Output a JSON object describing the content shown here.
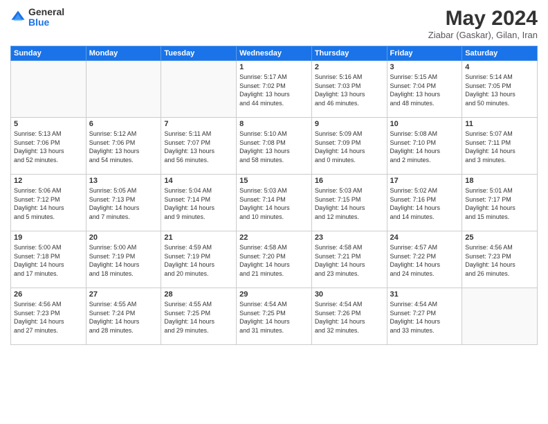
{
  "logo": {
    "general": "General",
    "blue": "Blue"
  },
  "header": {
    "month_year": "May 2024",
    "location": "Ziabar (Gaskar), Gilan, Iran"
  },
  "days_of_week": [
    "Sunday",
    "Monday",
    "Tuesday",
    "Wednesday",
    "Thursday",
    "Friday",
    "Saturday"
  ],
  "weeks": [
    [
      {
        "day": "",
        "info": ""
      },
      {
        "day": "",
        "info": ""
      },
      {
        "day": "",
        "info": ""
      },
      {
        "day": "1",
        "info": "Sunrise: 5:17 AM\nSunset: 7:02 PM\nDaylight: 13 hours\nand 44 minutes."
      },
      {
        "day": "2",
        "info": "Sunrise: 5:16 AM\nSunset: 7:03 PM\nDaylight: 13 hours\nand 46 minutes."
      },
      {
        "day": "3",
        "info": "Sunrise: 5:15 AM\nSunset: 7:04 PM\nDaylight: 13 hours\nand 48 minutes."
      },
      {
        "day": "4",
        "info": "Sunrise: 5:14 AM\nSunset: 7:05 PM\nDaylight: 13 hours\nand 50 minutes."
      }
    ],
    [
      {
        "day": "5",
        "info": "Sunrise: 5:13 AM\nSunset: 7:06 PM\nDaylight: 13 hours\nand 52 minutes."
      },
      {
        "day": "6",
        "info": "Sunrise: 5:12 AM\nSunset: 7:06 PM\nDaylight: 13 hours\nand 54 minutes."
      },
      {
        "day": "7",
        "info": "Sunrise: 5:11 AM\nSunset: 7:07 PM\nDaylight: 13 hours\nand 56 minutes."
      },
      {
        "day": "8",
        "info": "Sunrise: 5:10 AM\nSunset: 7:08 PM\nDaylight: 13 hours\nand 58 minutes."
      },
      {
        "day": "9",
        "info": "Sunrise: 5:09 AM\nSunset: 7:09 PM\nDaylight: 14 hours\nand 0 minutes."
      },
      {
        "day": "10",
        "info": "Sunrise: 5:08 AM\nSunset: 7:10 PM\nDaylight: 14 hours\nand 2 minutes."
      },
      {
        "day": "11",
        "info": "Sunrise: 5:07 AM\nSunset: 7:11 PM\nDaylight: 14 hours\nand 3 minutes."
      }
    ],
    [
      {
        "day": "12",
        "info": "Sunrise: 5:06 AM\nSunset: 7:12 PM\nDaylight: 14 hours\nand 5 minutes."
      },
      {
        "day": "13",
        "info": "Sunrise: 5:05 AM\nSunset: 7:13 PM\nDaylight: 14 hours\nand 7 minutes."
      },
      {
        "day": "14",
        "info": "Sunrise: 5:04 AM\nSunset: 7:14 PM\nDaylight: 14 hours\nand 9 minutes."
      },
      {
        "day": "15",
        "info": "Sunrise: 5:03 AM\nSunset: 7:14 PM\nDaylight: 14 hours\nand 10 minutes."
      },
      {
        "day": "16",
        "info": "Sunrise: 5:03 AM\nSunset: 7:15 PM\nDaylight: 14 hours\nand 12 minutes."
      },
      {
        "day": "17",
        "info": "Sunrise: 5:02 AM\nSunset: 7:16 PM\nDaylight: 14 hours\nand 14 minutes."
      },
      {
        "day": "18",
        "info": "Sunrise: 5:01 AM\nSunset: 7:17 PM\nDaylight: 14 hours\nand 15 minutes."
      }
    ],
    [
      {
        "day": "19",
        "info": "Sunrise: 5:00 AM\nSunset: 7:18 PM\nDaylight: 14 hours\nand 17 minutes."
      },
      {
        "day": "20",
        "info": "Sunrise: 5:00 AM\nSunset: 7:19 PM\nDaylight: 14 hours\nand 18 minutes."
      },
      {
        "day": "21",
        "info": "Sunrise: 4:59 AM\nSunset: 7:19 PM\nDaylight: 14 hours\nand 20 minutes."
      },
      {
        "day": "22",
        "info": "Sunrise: 4:58 AM\nSunset: 7:20 PM\nDaylight: 14 hours\nand 21 minutes."
      },
      {
        "day": "23",
        "info": "Sunrise: 4:58 AM\nSunset: 7:21 PM\nDaylight: 14 hours\nand 23 minutes."
      },
      {
        "day": "24",
        "info": "Sunrise: 4:57 AM\nSunset: 7:22 PM\nDaylight: 14 hours\nand 24 minutes."
      },
      {
        "day": "25",
        "info": "Sunrise: 4:56 AM\nSunset: 7:23 PM\nDaylight: 14 hours\nand 26 minutes."
      }
    ],
    [
      {
        "day": "26",
        "info": "Sunrise: 4:56 AM\nSunset: 7:23 PM\nDaylight: 14 hours\nand 27 minutes."
      },
      {
        "day": "27",
        "info": "Sunrise: 4:55 AM\nSunset: 7:24 PM\nDaylight: 14 hours\nand 28 minutes."
      },
      {
        "day": "28",
        "info": "Sunrise: 4:55 AM\nSunset: 7:25 PM\nDaylight: 14 hours\nand 29 minutes."
      },
      {
        "day": "29",
        "info": "Sunrise: 4:54 AM\nSunset: 7:25 PM\nDaylight: 14 hours\nand 31 minutes."
      },
      {
        "day": "30",
        "info": "Sunrise: 4:54 AM\nSunset: 7:26 PM\nDaylight: 14 hours\nand 32 minutes."
      },
      {
        "day": "31",
        "info": "Sunrise: 4:54 AM\nSunset: 7:27 PM\nDaylight: 14 hours\nand 33 minutes."
      },
      {
        "day": "",
        "info": ""
      }
    ]
  ]
}
